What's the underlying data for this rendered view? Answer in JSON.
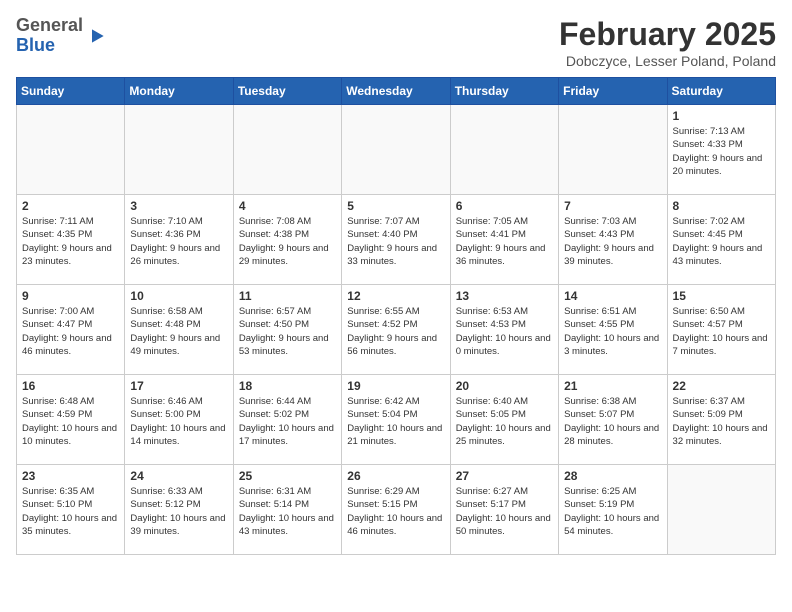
{
  "logo": {
    "general": "General",
    "blue": "Blue"
  },
  "header": {
    "month": "February 2025",
    "location": "Dobczyce, Lesser Poland, Poland"
  },
  "weekdays": [
    "Sunday",
    "Monday",
    "Tuesday",
    "Wednesday",
    "Thursday",
    "Friday",
    "Saturday"
  ],
  "weeks": [
    [
      {
        "day": "",
        "info": ""
      },
      {
        "day": "",
        "info": ""
      },
      {
        "day": "",
        "info": ""
      },
      {
        "day": "",
        "info": ""
      },
      {
        "day": "",
        "info": ""
      },
      {
        "day": "",
        "info": ""
      },
      {
        "day": "1",
        "info": "Sunrise: 7:13 AM\nSunset: 4:33 PM\nDaylight: 9 hours and 20 minutes."
      }
    ],
    [
      {
        "day": "2",
        "info": "Sunrise: 7:11 AM\nSunset: 4:35 PM\nDaylight: 9 hours and 23 minutes."
      },
      {
        "day": "3",
        "info": "Sunrise: 7:10 AM\nSunset: 4:36 PM\nDaylight: 9 hours and 26 minutes."
      },
      {
        "day": "4",
        "info": "Sunrise: 7:08 AM\nSunset: 4:38 PM\nDaylight: 9 hours and 29 minutes."
      },
      {
        "day": "5",
        "info": "Sunrise: 7:07 AM\nSunset: 4:40 PM\nDaylight: 9 hours and 33 minutes."
      },
      {
        "day": "6",
        "info": "Sunrise: 7:05 AM\nSunset: 4:41 PM\nDaylight: 9 hours and 36 minutes."
      },
      {
        "day": "7",
        "info": "Sunrise: 7:03 AM\nSunset: 4:43 PM\nDaylight: 9 hours and 39 minutes."
      },
      {
        "day": "8",
        "info": "Sunrise: 7:02 AM\nSunset: 4:45 PM\nDaylight: 9 hours and 43 minutes."
      }
    ],
    [
      {
        "day": "9",
        "info": "Sunrise: 7:00 AM\nSunset: 4:47 PM\nDaylight: 9 hours and 46 minutes."
      },
      {
        "day": "10",
        "info": "Sunrise: 6:58 AM\nSunset: 4:48 PM\nDaylight: 9 hours and 49 minutes."
      },
      {
        "day": "11",
        "info": "Sunrise: 6:57 AM\nSunset: 4:50 PM\nDaylight: 9 hours and 53 minutes."
      },
      {
        "day": "12",
        "info": "Sunrise: 6:55 AM\nSunset: 4:52 PM\nDaylight: 9 hours and 56 minutes."
      },
      {
        "day": "13",
        "info": "Sunrise: 6:53 AM\nSunset: 4:53 PM\nDaylight: 10 hours and 0 minutes."
      },
      {
        "day": "14",
        "info": "Sunrise: 6:51 AM\nSunset: 4:55 PM\nDaylight: 10 hours and 3 minutes."
      },
      {
        "day": "15",
        "info": "Sunrise: 6:50 AM\nSunset: 4:57 PM\nDaylight: 10 hours and 7 minutes."
      }
    ],
    [
      {
        "day": "16",
        "info": "Sunrise: 6:48 AM\nSunset: 4:59 PM\nDaylight: 10 hours and 10 minutes."
      },
      {
        "day": "17",
        "info": "Sunrise: 6:46 AM\nSunset: 5:00 PM\nDaylight: 10 hours and 14 minutes."
      },
      {
        "day": "18",
        "info": "Sunrise: 6:44 AM\nSunset: 5:02 PM\nDaylight: 10 hours and 17 minutes."
      },
      {
        "day": "19",
        "info": "Sunrise: 6:42 AM\nSunset: 5:04 PM\nDaylight: 10 hours and 21 minutes."
      },
      {
        "day": "20",
        "info": "Sunrise: 6:40 AM\nSunset: 5:05 PM\nDaylight: 10 hours and 25 minutes."
      },
      {
        "day": "21",
        "info": "Sunrise: 6:38 AM\nSunset: 5:07 PM\nDaylight: 10 hours and 28 minutes."
      },
      {
        "day": "22",
        "info": "Sunrise: 6:37 AM\nSunset: 5:09 PM\nDaylight: 10 hours and 32 minutes."
      }
    ],
    [
      {
        "day": "23",
        "info": "Sunrise: 6:35 AM\nSunset: 5:10 PM\nDaylight: 10 hours and 35 minutes."
      },
      {
        "day": "24",
        "info": "Sunrise: 6:33 AM\nSunset: 5:12 PM\nDaylight: 10 hours and 39 minutes."
      },
      {
        "day": "25",
        "info": "Sunrise: 6:31 AM\nSunset: 5:14 PM\nDaylight: 10 hours and 43 minutes."
      },
      {
        "day": "26",
        "info": "Sunrise: 6:29 AM\nSunset: 5:15 PM\nDaylight: 10 hours and 46 minutes."
      },
      {
        "day": "27",
        "info": "Sunrise: 6:27 AM\nSunset: 5:17 PM\nDaylight: 10 hours and 50 minutes."
      },
      {
        "day": "28",
        "info": "Sunrise: 6:25 AM\nSunset: 5:19 PM\nDaylight: 10 hours and 54 minutes."
      },
      {
        "day": "",
        "info": ""
      }
    ]
  ]
}
